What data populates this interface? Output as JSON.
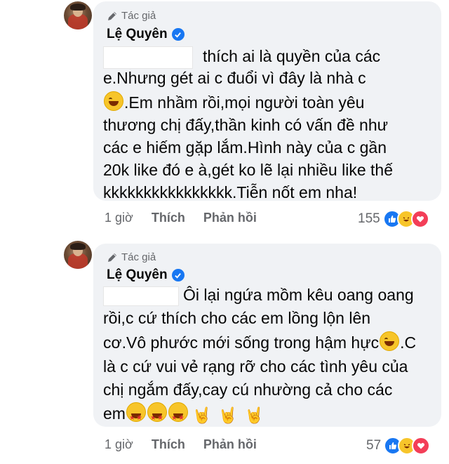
{
  "comments": [
    {
      "author_badge": "Tác giả",
      "author_name": "Lệ Quyên",
      "lines": [
        "thích ai là quyền của các",
        "e.Nhưng gét ai c đuổi vì đây là nhà c",
        ".Em nhầm rồi,mọi người toàn yêu",
        "thương chị đấy,thần kinh có vấn đề như",
        "các e hiếm gặp lắm.Hình này của c gần",
        "20k like đó e à,gét ko lẽ lại nhiều like thế",
        "kkkkkkkkkkkkkkkk.Tiễn nốt em nha!"
      ],
      "time": "1 giờ",
      "like_label": "Thích",
      "reply_label": "Phản hồi",
      "reaction_count": "155",
      "reactions": [
        "like-icon",
        "haha-icon",
        "love-icon"
      ]
    },
    {
      "author_badge": "Tác giả",
      "author_name": "Lệ Quyên",
      "lines": [
        "Ôi lại ngứa mồm kêu oang oang",
        "rồi,c cứ thích cho các em lồng lộn lên",
        "cơ.Vô phước mới sống trong hậm hực",
        ".C",
        "là c cứ vui vẻ rạng rỡ cho các tình yêu của",
        "chị ngắm đấy,cay cú nhường cả cho các",
        "em"
      ],
      "time": "1 giờ",
      "like_label": "Thích",
      "reply_label": "Phản hồi",
      "reaction_count": "57",
      "reactions": [
        "like-icon",
        "haha-icon",
        "love-icon"
      ]
    }
  ],
  "colors": {
    "bubble": "#f0f2f5",
    "verified": "#1877f2",
    "meta": "#65676b"
  }
}
